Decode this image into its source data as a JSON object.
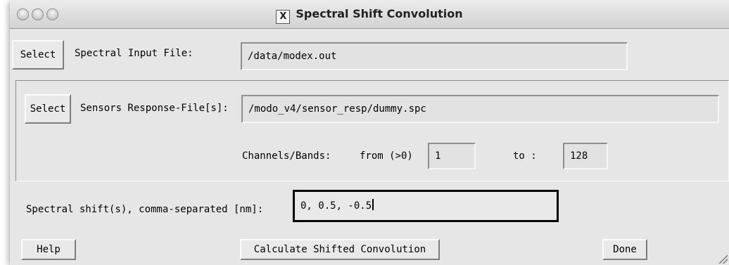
{
  "window": {
    "title": "Spectral Shift Convolution",
    "title_icon": "X"
  },
  "input_file": {
    "select_label": "Select",
    "label": "Spectral Input File:",
    "value": "/data/modex.out"
  },
  "sensor": {
    "select_label": "Select",
    "label": "Sensors Response-File[s]:",
    "value": "/modo_v4/sensor_resp/dummy.spc"
  },
  "channels": {
    "label": "Channels/Bands:",
    "from_label": "from (>0)",
    "from_value": "1",
    "to_label": "to :",
    "to_value": "128"
  },
  "shift": {
    "label": "Spectral shift(s), comma-separated [nm]:",
    "value": "0, 0.5, -0.5"
  },
  "buttons": {
    "help": "Help",
    "calculate": "Calculate Shifted Convolution",
    "done": "Done"
  }
}
